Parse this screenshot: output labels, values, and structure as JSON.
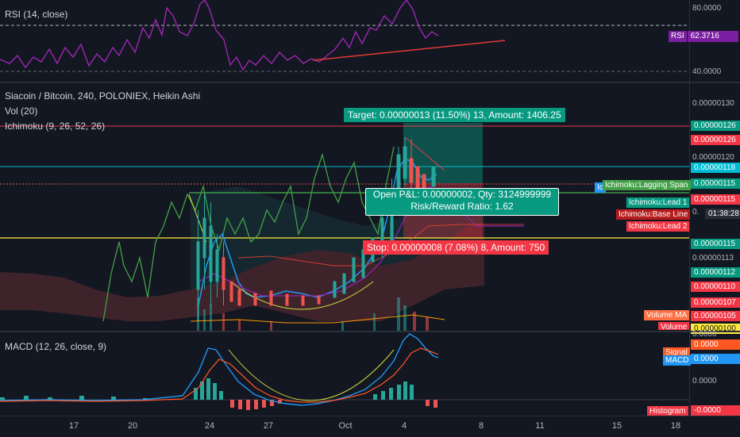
{
  "rsi": {
    "legend": "RSI (14, close)",
    "ticks": [
      "80.0000",
      "40.0000"
    ],
    "tag_label": "RSI",
    "tag_value": "62.3716"
  },
  "main": {
    "symbol_legend": "Siacoin / Bitcoin, 240, POLONIEX, Heikin Ashi",
    "vol_legend": "Vol (20)",
    "ichimoku_legend": "Ichimoku (9, 26, 52, 26)",
    "axis_ticks": [
      "0.00000130",
      "0.00000120",
      "0.00000113",
      "0.00000105",
      "0.00000100"
    ],
    "price_tags": [
      {
        "value": "0.00000126",
        "color": "#089981"
      },
      {
        "value": "0.00000126",
        "color": "#f23645"
      },
      {
        "value": "0.00000118",
        "color": "#00bcd4"
      },
      {
        "value": "0.00000115",
        "color": "#089981"
      },
      {
        "value": "0.00000115",
        "color": "#f23645"
      },
      {
        "value": "0.00000115",
        "color": "#089981"
      },
      {
        "value": "0.00000112",
        "color": "#089981"
      },
      {
        "value": "0.00000110",
        "color": "#f23645"
      },
      {
        "value": "0.00000107",
        "color": "#f23645"
      },
      {
        "value": "0.00000105",
        "color": "#f23645"
      }
    ],
    "countdown": "01:38:28",
    "axis_partial": "0.",
    "axis_partial_2": "0.00000113",
    "target_label": "Target: 0.00000013 (11.50%) 13, Amount: 1406.25",
    "open_pl_label": "Open P&L: 0.00000002, Qty: 3124999999",
    "risk_reward_label": "Risk/Reward Ratio: 1.62",
    "stop_label": "Stop: 0.00000008 (7.08%) 8, Amount: 750",
    "lagging_span": "Ichimoku:Lagging Span",
    "lead1": "Ichimoku:Lead 1",
    "base_line": "Ichimoku:Base Line",
    "lead2": "Ichimoku:Lead 2",
    "volume_ma": "Volume MA",
    "volume": "Volume",
    "cut_tag": "Ic"
  },
  "macd": {
    "legend": "MACD (12, 26, close, 9)",
    "ticks": [
      "0.0000",
      "0.0000"
    ],
    "signal_label": "Signal",
    "signal_value": "0.0000",
    "macd_label": "MACD",
    "macd_value": "0.0000",
    "histogram_label": "Histogram",
    "histogram_value": "-0.0000"
  },
  "x_axis": [
    "17",
    "20",
    "24",
    "27",
    "Oct",
    "4",
    "8",
    "11",
    "15",
    "18"
  ],
  "colors": {
    "background": "#131722",
    "up": "#26a69a",
    "down": "#ef5350",
    "rsi_line": "#9c27b0",
    "target_green": "#089981",
    "stop_red": "#f23645",
    "cyan": "#00bcd4",
    "yellow": "#ffeb3b"
  }
}
